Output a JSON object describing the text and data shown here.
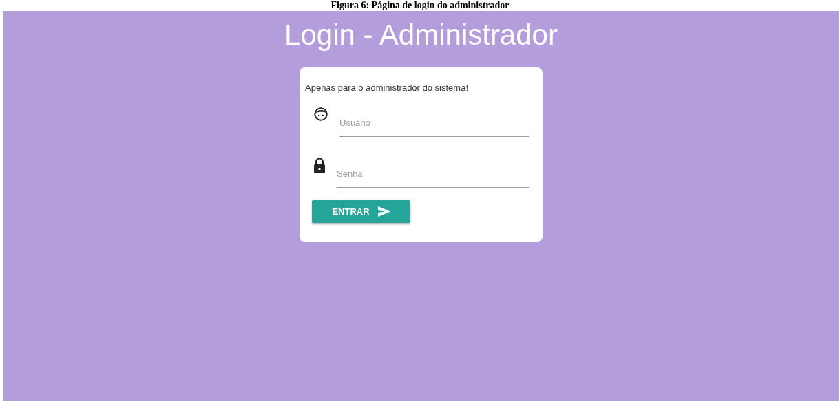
{
  "caption": "Figura 6: Página de login do administrador",
  "title": "Login - Administrador",
  "card": {
    "notice": "Apenas para o administrador do sistema!",
    "fields": [
      {
        "kind": "user",
        "placeholder": "Usuário"
      },
      {
        "kind": "password",
        "placeholder": "Senha"
      }
    ],
    "button": "ENTRAR"
  }
}
